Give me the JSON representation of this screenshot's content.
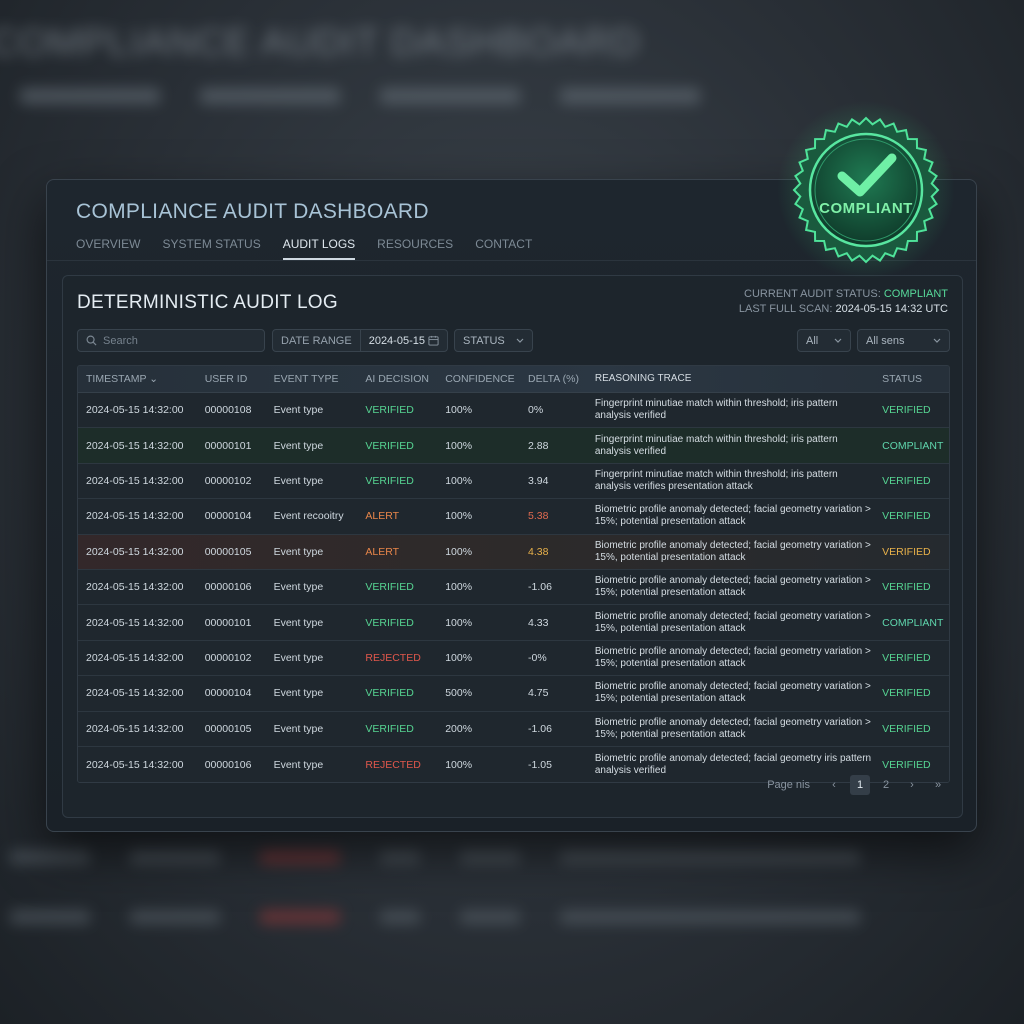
{
  "backdrop": {
    "title": "COMPLIANCE AUDIT DASHBOARD"
  },
  "app": {
    "title": "COMPLIANCE AUDIT DASHBOARD"
  },
  "nav": {
    "tabs": [
      {
        "label": "OVERVIEW",
        "active": false
      },
      {
        "label": "SYSTEM STATUS",
        "active": false
      },
      {
        "label": "AUDIT LOGS",
        "active": true
      },
      {
        "label": "RESOURCES",
        "active": false
      },
      {
        "label": "CONTACT",
        "active": false
      }
    ]
  },
  "badge": {
    "label": "COMPLIANT",
    "color": "#3fe08a",
    "icon": "check-icon"
  },
  "panel": {
    "title": "DETERMINISTIC AUDIT LOG",
    "status_label": "CURRENT AUDIT STATUS:",
    "status_value": "COMPLIANT",
    "scan_label": "LAST FULL SCAN:",
    "scan_value": "2024-05-15 14:32 UTC"
  },
  "filters": {
    "search_placeholder": "Search",
    "date_label": "DATE RANGE",
    "date_value": "2024-05-15",
    "status_select": "STATUS",
    "all_select": "All",
    "sens_select": "All sens"
  },
  "table": {
    "columns": [
      "TIMESTAMP",
      "USER ID",
      "EVENT TYPE",
      "AI DECISION",
      "CONFIDENCE",
      "DELTA (%)",
      "REASONING TRACE",
      "STATUS"
    ],
    "rows": [
      {
        "timestamp": "2024-05-15 14:32:00",
        "user_id": "00000108",
        "event": "Event type",
        "decision": "VERIFIED",
        "confidence": "100%",
        "delta": "0%",
        "trace": "Fingerprint minutiae match within threshold; iris pattern analysis verified",
        "status": "VERIFIED"
      },
      {
        "timestamp": "2024-05-15 14:32:00",
        "user_id": "00000101",
        "event": "Event type",
        "decision": "VERIFIED",
        "confidence": "100%",
        "delta": "2.88",
        "trace": "Fingerprint minutiae match within threshold; iris pattern analysis verified",
        "status": "COMPLIANT"
      },
      {
        "timestamp": "2024-05-15 14:32:00",
        "user_id": "00000102",
        "event": "Event type",
        "decision": "VERIFIED",
        "confidence": "100%",
        "delta": "3.94",
        "trace": "Fingerprint minutiae match within threshold; iris pattern analysis verifies presentation attack",
        "status": "VERIFIED"
      },
      {
        "timestamp": "2024-05-15 14:32:00",
        "user_id": "00000104",
        "event": "Event recooitry",
        "decision": "ALERT",
        "confidence": "100%",
        "delta": "5.38",
        "trace": "Biometric profile anomaly detected; facial geometry variation > 15%; potential presentation attack",
        "status": "VERIFIED"
      },
      {
        "timestamp": "2024-05-15 14:32:00",
        "user_id": "00000105",
        "event": "Event type",
        "decision": "ALERT",
        "confidence": "100%",
        "delta": "4.38",
        "trace": "Biometric profile anomaly detected; facial geometry variation > 15%, potential presentation attack",
        "status": "VERIFIED"
      },
      {
        "timestamp": "2024-05-15 14:32:00",
        "user_id": "00000106",
        "event": "Event type",
        "decision": "VERIFIED",
        "confidence": "100%",
        "delta": "-1.06",
        "trace": "Biometric profile anomaly detected; facial geometry variation > 15%; potential presentation attack",
        "status": "VERIFIED"
      },
      {
        "timestamp": "2024-05-15 14:32:00",
        "user_id": "00000101",
        "event": "Event type",
        "decision": "VERIFIED",
        "confidence": "100%",
        "delta": "4.33",
        "trace": "Biometric profile anomaly detected; facial geometry variation > 15%, potential presentation attack",
        "status": "COMPLIANT"
      },
      {
        "timestamp": "2024-05-15 14:32:00",
        "user_id": "00000102",
        "event": "Event type",
        "decision": "REJECTED",
        "confidence": "100%",
        "delta": "-0%",
        "trace": "Biometric profile anomaly detected; facial geometry variation > 15%; potential presentation attack",
        "status": "VERIFIED"
      },
      {
        "timestamp": "2024-05-15 14:32:00",
        "user_id": "00000104",
        "event": "Event type",
        "decision": "VERIFIED",
        "confidence": "500%",
        "delta": "4.75",
        "trace": "Biometric profile anomaly detected; facial geometry variation > 15%; potential presentation attack",
        "status": "VERIFIED"
      },
      {
        "timestamp": "2024-05-15 14:32:00",
        "user_id": "00000105",
        "event": "Event type",
        "decision": "VERIFIED",
        "confidence": "200%",
        "delta": "-1.06",
        "trace": "Biometric profile anomaly detected; facial geometry variation > 15%; potential presentation attack",
        "status": "VERIFIED"
      },
      {
        "timestamp": "2024-05-15 14:32:00",
        "user_id": "00000106",
        "event": "Event type",
        "decision": "REJECTED",
        "confidence": "100%",
        "delta": "-1.05",
        "trace": "Biometric profile anomaly detected; facial geometry iris pattern analysis verified",
        "status": "VERIFIED"
      }
    ]
  },
  "pagination": {
    "label": "Page nis",
    "pages": [
      "1",
      "2"
    ],
    "current": "1"
  }
}
